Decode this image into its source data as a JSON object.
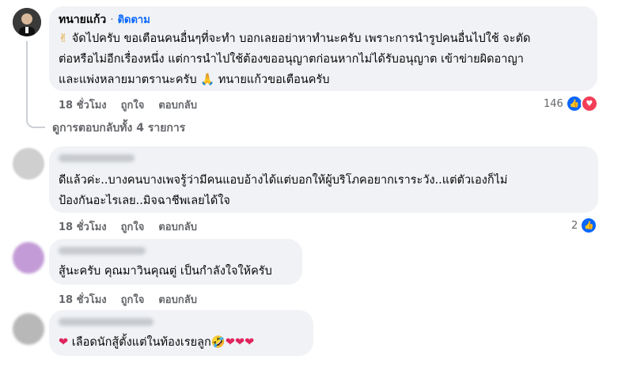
{
  "comments": [
    {
      "author": "ทนายแก้ว",
      "separator": "·",
      "follow": "ติดตาม",
      "emoji_start": "✌",
      "line1": "จัดไปครับ ขอเตือนคนอื่นๆที่จะทำ บอกเลยอย่าหาทำนะครับ เพราะการนำรูปคนอื่นไปใช้ จะตัด",
      "line2": "ต่อหรือไม่อีกเรื่องหนึ่ง แต่การนำไปใช้ต้องขออนุญาตก่อนหากไม่ได้รับอนุญาต เข้าข่ายผิดอาญา",
      "line3": "และแพ่งหลายมาตรานะครับ",
      "emoji_pray": "🙏",
      "line3b": "ทนายแก้วขอเตือนครับ",
      "time": "18 ชั่วโมง",
      "like": "ถูกใจ",
      "reply": "ตอบกลับ",
      "reaction_count": "146",
      "reaction_icons": [
        "like-icon",
        "love-icon"
      ]
    },
    {
      "line1": "ดีแล้วค่ะ..บางคนบางเพจรู้ว่ามีคนแอบอ้างได้แต่บอกให้ผู้บริโภคอยากเราระวัง..แต่ตัวเองก็ไม่",
      "line2": "ป้องกันอะไรเลย..มิจฉาชีพเลยได้ใจ",
      "time": "18 ชั่วโมง",
      "like": "ถูกใจ",
      "reply": "ตอบกลับ",
      "reaction_count": "2",
      "reaction_icons": [
        "like-icon"
      ]
    },
    {
      "line1": "สู้นะครับ คุณมาวินคุณตู่ เป็นกำลังใจให้ครับ",
      "time": "18 ชั่วโมง",
      "like": "ถูกใจ",
      "reply": "ตอบกลับ"
    },
    {
      "heart": "❤",
      "line1": "เลือดนักสู้ตั้งแต่ในท้องเรยลูก",
      "emoji_tail": "🤣❤❤❤"
    }
  ],
  "view_replies": "ดูการตอบกลับทั้ง 4 รายการ",
  "colors": {
    "accent": "#0866ff",
    "love": "#f33e58",
    "bubble": "#f0f2f5",
    "muted": "#65676b"
  }
}
